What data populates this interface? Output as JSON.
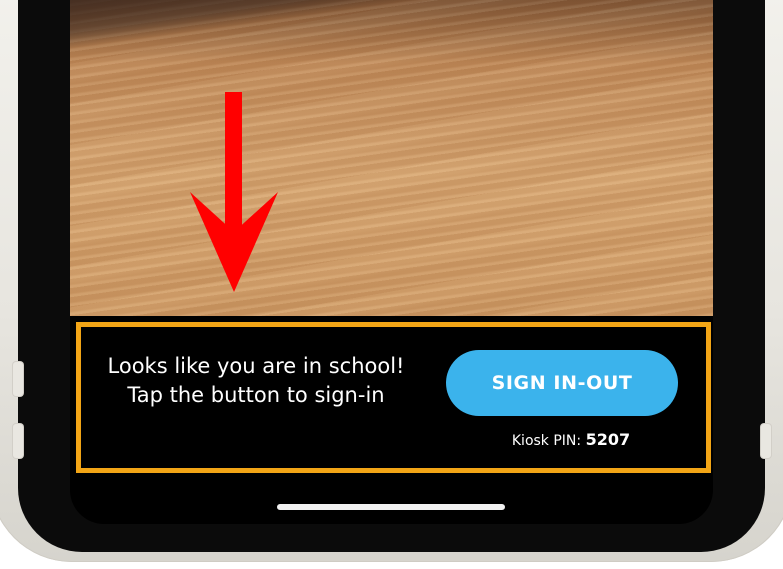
{
  "banner": {
    "message": "Looks like you are in school! Tap the button to sign-in",
    "button_label": "SIGN IN-OUT",
    "kiosk_pin_label": "Kiosk PIN:",
    "kiosk_pin_value": "5207"
  },
  "icons": {
    "arrow": "down-arrow-icon"
  },
  "colors": {
    "banner_border": "#f2a516",
    "button_background": "#3bb3ec",
    "arrow": "#ff0000"
  }
}
